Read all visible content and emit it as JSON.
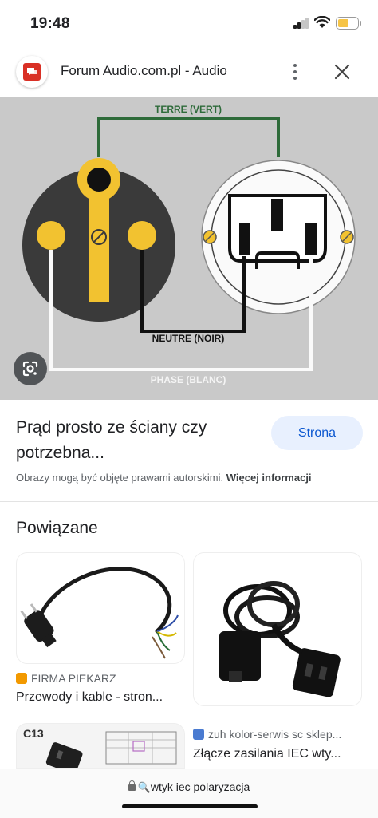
{
  "status_bar": {
    "time": "19:48",
    "battery_level": 0.55
  },
  "header": {
    "site_name": "Forum Audio.com.pl - Audio",
    "site_icon": "forum-chat-icon"
  },
  "image": {
    "alt_labels": {
      "ground": "TERRE (VERT)",
      "neutral": "NEUTRE (NOIR)",
      "phase": "PHASE (BLANC)"
    },
    "lens_icon": "google-lens-icon"
  },
  "result": {
    "title": "Prąd prosto ze ściany czy potrzebna...",
    "visit_button": "Strona",
    "copyright_text": "Obrazy mogą być objęte prawami autorskimi.",
    "copyright_link": "Więcej informacji"
  },
  "related": {
    "heading": "Powiązane",
    "items": [
      {
        "source": "FIRMA PIEKARZ",
        "caption": "Przewody i kable - stron...",
        "fav_color": "#f29900"
      },
      {
        "source": "",
        "caption": "",
        "fav_color": ""
      },
      {
        "source": "",
        "caption": "",
        "fav_color": "",
        "thumb_label": "C13"
      },
      {
        "source": "zuh kolor-serwis sc sklep...",
        "caption": "Złącze zasilania IEC wty...",
        "fav_color": "#4a7bd1"
      }
    ]
  },
  "url_bar": {
    "text": "wtyk iec polaryzacja"
  },
  "colors": {
    "accent": "#0b57d0",
    "accent_bg": "#e8f0fe",
    "wire_green": "#2e6b3a",
    "plug_yellow": "#f2c230"
  }
}
